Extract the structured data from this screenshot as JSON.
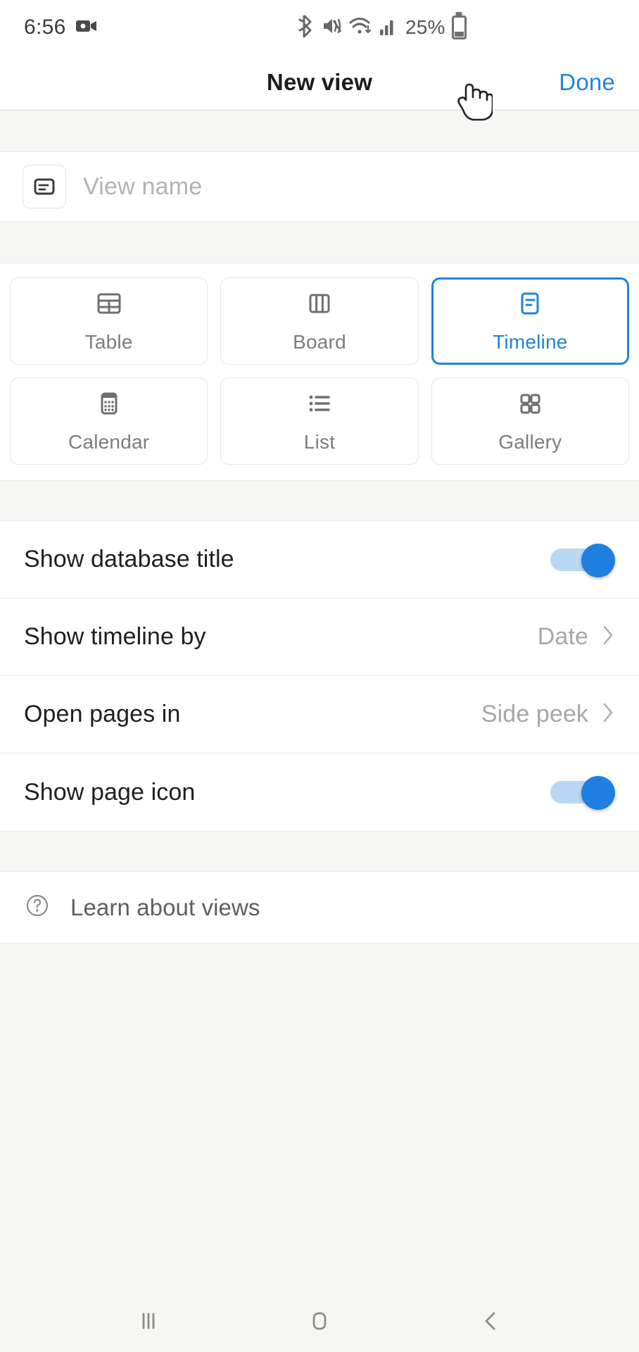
{
  "status_bar": {
    "time": "6:56",
    "battery_percent": "25%",
    "icons": [
      "screen-record-icon",
      "bluetooth-icon",
      "mute-vibrate-icon",
      "wifi-icon",
      "cellular-signal-icon",
      "battery-icon"
    ]
  },
  "header": {
    "title": "New view",
    "done_label": "Done",
    "done_color": "#2383d6"
  },
  "view_name": {
    "placeholder": "View name",
    "value": "",
    "icon": "timeline-doc-icon"
  },
  "view_types": {
    "selected": "Timeline",
    "accent_color": "#2383d6",
    "items": [
      {
        "label": "Table",
        "icon": "table-icon",
        "selected": false
      },
      {
        "label": "Board",
        "icon": "board-icon",
        "selected": false
      },
      {
        "label": "Timeline",
        "icon": "timeline-icon",
        "selected": true
      },
      {
        "label": "Calendar",
        "icon": "calendar-icon",
        "selected": false
      },
      {
        "label": "List",
        "icon": "list-icon",
        "selected": false
      },
      {
        "label": "Gallery",
        "icon": "gallery-icon",
        "selected": false
      }
    ]
  },
  "settings": [
    {
      "title": "Show database title",
      "control": "toggle",
      "value": "on"
    },
    {
      "title": "Show timeline by",
      "control": "disclosure",
      "value": "Date"
    },
    {
      "title": "Open pages in",
      "control": "disclosure",
      "value": "Side peek"
    },
    {
      "title": "Show page icon",
      "control": "toggle",
      "value": "on"
    }
  ],
  "learn": {
    "label": "Learn about views",
    "icon": "help-circle-icon"
  },
  "nav_bar": {
    "recents_label": "recents-icon",
    "home_label": "home-icon",
    "back_label": "back-icon"
  }
}
